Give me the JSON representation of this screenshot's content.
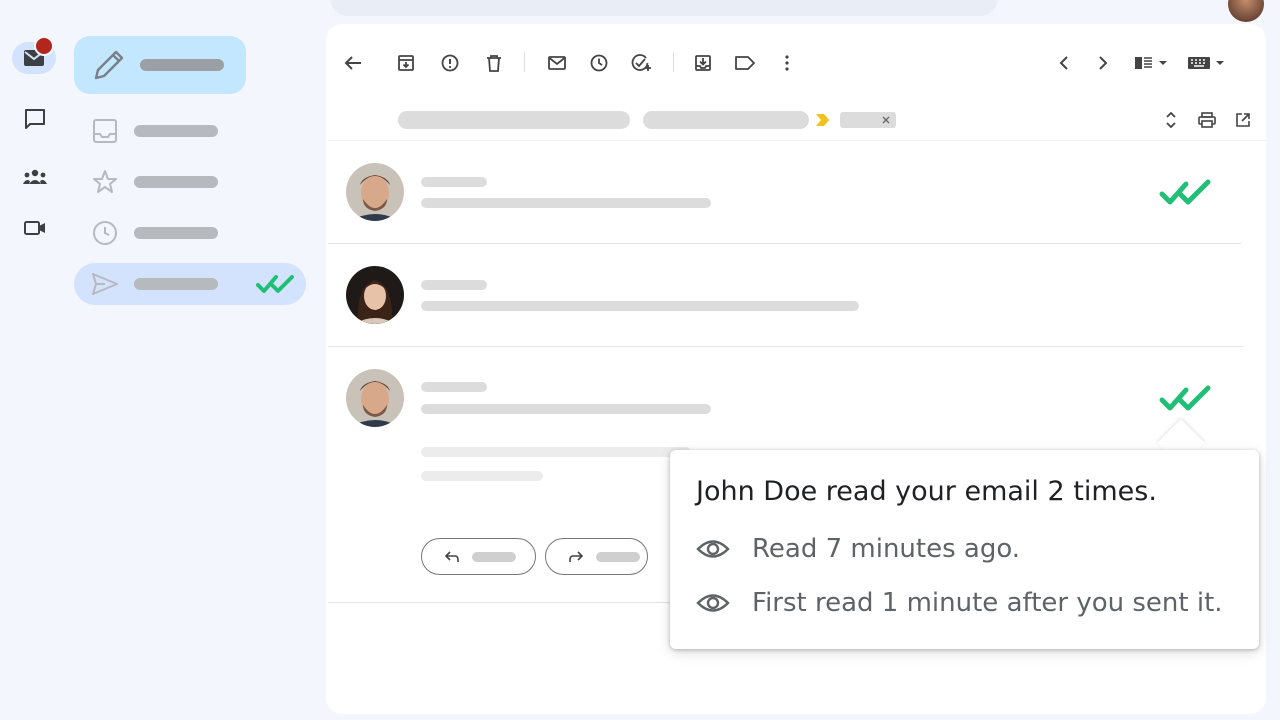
{
  "colors": {
    "accent_green": "#1fbf75",
    "compose_bg": "#c2e7ff",
    "active_nav_bg": "#d3e3fd",
    "badge_red": "#b3261e"
  },
  "rail": {
    "icons": [
      "mail-icon",
      "chat-icon",
      "spaces-icon",
      "meet-icon"
    ]
  },
  "nav": {
    "items": [
      {
        "icon": "inbox-icon"
      },
      {
        "icon": "star-icon"
      },
      {
        "icon": "clock-icon"
      },
      {
        "icon": "send-icon",
        "active": true
      }
    ]
  },
  "toolbar": {
    "icons": [
      "back-arrow-icon",
      "archive-icon",
      "report-spam-icon",
      "delete-icon",
      "mark-unread-icon",
      "snooze-icon",
      "add-task-icon",
      "move-to-icon",
      "label-icon",
      "more-icon",
      "prev-icon",
      "next-icon",
      "split-pane-icon",
      "keyboard-icon"
    ]
  },
  "tooltip": {
    "title": "John Doe read your email 2 times.",
    "line1": "Read 7 minutes ago.",
    "line2": "First read 1 minute after you sent it."
  }
}
